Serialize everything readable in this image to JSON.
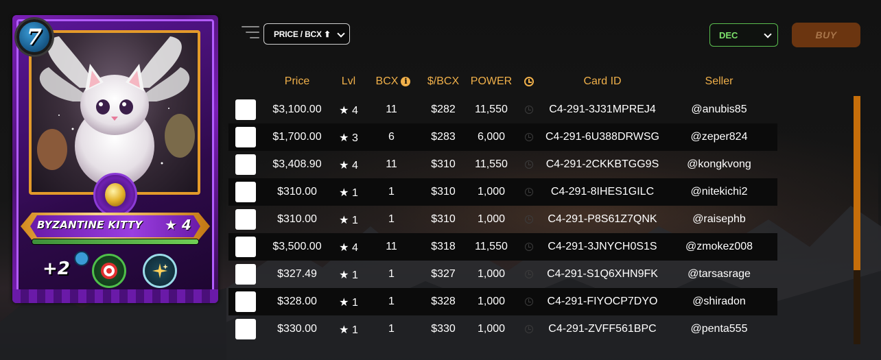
{
  "card": {
    "mana": "7",
    "name": "BYZANTINE KITTY",
    "level": "★ 4",
    "xp_fraction": 1.0,
    "ability_buff": "+2",
    "abilities": [
      "target-icon",
      "sparkle-icon"
    ]
  },
  "toolbar": {
    "sort_label": "PRICE / BCX ⬆",
    "currency": "DEC",
    "buy_label": "BUY"
  },
  "table": {
    "headers": {
      "price": "Price",
      "lvl": "Lvl",
      "bcx": "BCX",
      "per_bcx": "$/BCX",
      "power": "POWER",
      "card_id": "Card ID",
      "seller": "Seller"
    },
    "rows": [
      {
        "price": "$3,100.00",
        "lvl": "★ 4",
        "bcx": "11",
        "per_bcx": "$282",
        "power": "11,550",
        "card_id": "C4-291-3J31MPREJ4",
        "seller": "@anubis85"
      },
      {
        "price": "$1,700.00",
        "lvl": "★ 3",
        "bcx": "6",
        "per_bcx": "$283",
        "power": "6,000",
        "card_id": "C4-291-6U388DRWSG",
        "seller": "@zeper824"
      },
      {
        "price": "$3,408.90",
        "lvl": "★ 4",
        "bcx": "11",
        "per_bcx": "$310",
        "power": "11,550",
        "card_id": "C4-291-2CKKBTGG9S",
        "seller": "@kongkvong"
      },
      {
        "price": "$310.00",
        "lvl": "★ 1",
        "bcx": "1",
        "per_bcx": "$310",
        "power": "1,000",
        "card_id": "C4-291-8IHES1GILC",
        "seller": "@nitekichi2"
      },
      {
        "price": "$310.00",
        "lvl": "★ 1",
        "bcx": "1",
        "per_bcx": "$310",
        "power": "1,000",
        "card_id": "C4-291-P8S61Z7QNK",
        "seller": "@raisephb"
      },
      {
        "price": "$3,500.00",
        "lvl": "★ 4",
        "bcx": "11",
        "per_bcx": "$318",
        "power": "11,550",
        "card_id": "C4-291-3JNYCH0S1S",
        "seller": "@zmokez008"
      },
      {
        "price": "$327.49",
        "lvl": "★ 1",
        "bcx": "1",
        "per_bcx": "$327",
        "power": "1,000",
        "card_id": "C4-291-S1Q6XHN9FK",
        "seller": "@tarsasrage"
      },
      {
        "price": "$328.00",
        "lvl": "★ 1",
        "bcx": "1",
        "per_bcx": "$328",
        "power": "1,000",
        "card_id": "C4-291-FIYOCP7DYO",
        "seller": "@shiradon"
      },
      {
        "price": "$330.00",
        "lvl": "★ 1",
        "bcx": "1",
        "per_bcx": "$330",
        "power": "1,000",
        "card_id": "C4-291-ZVFF561BPC",
        "seller": "@penta555"
      }
    ]
  },
  "colors": {
    "header_accent": "#f0b04a",
    "currency_accent": "#7de26b",
    "buy_button_bg": "#6b3510",
    "scroll_thumb": "#c66e0a"
  }
}
